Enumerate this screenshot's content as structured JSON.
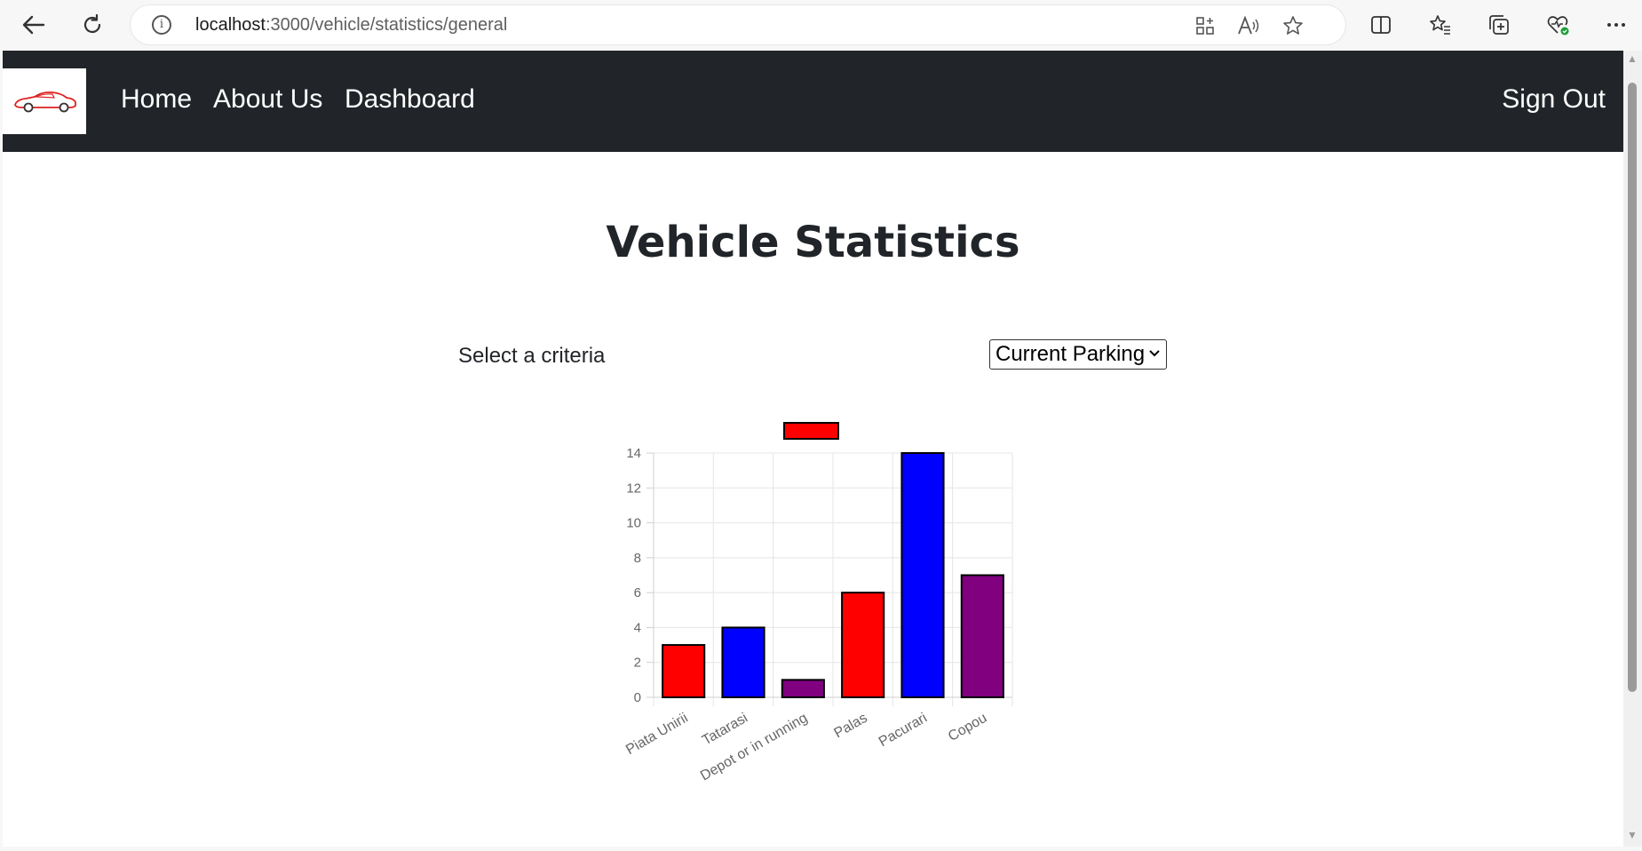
{
  "browser": {
    "url_host": "localhost",
    "url_path": ":3000/vehicle/statistics/general"
  },
  "navbar": {
    "links": [
      "Home",
      "About Us",
      "Dashboard"
    ],
    "sign_out": "Sign Out"
  },
  "page": {
    "title": "Vehicle Statistics",
    "criteria_label": "Select a criteria",
    "criteria_selected": "Current Parking"
  },
  "chart_data": {
    "type": "bar",
    "categories": [
      "Piata Unirii",
      "Tatarasi",
      "Depot or in running",
      "Palas",
      "Pacurari",
      "Copou"
    ],
    "values": [
      3,
      4,
      1,
      6,
      14,
      7
    ],
    "colors": [
      "#ff0000",
      "#0000ff",
      "#800080",
      "#ff0000",
      "#0000ff",
      "#800080"
    ],
    "legend_color": "#ff0000",
    "legend_label": "",
    "ylim": [
      0,
      14
    ],
    "yticks": [
      0,
      2,
      4,
      6,
      8,
      10,
      12,
      14
    ],
    "grid": true,
    "legend_position": "top"
  }
}
